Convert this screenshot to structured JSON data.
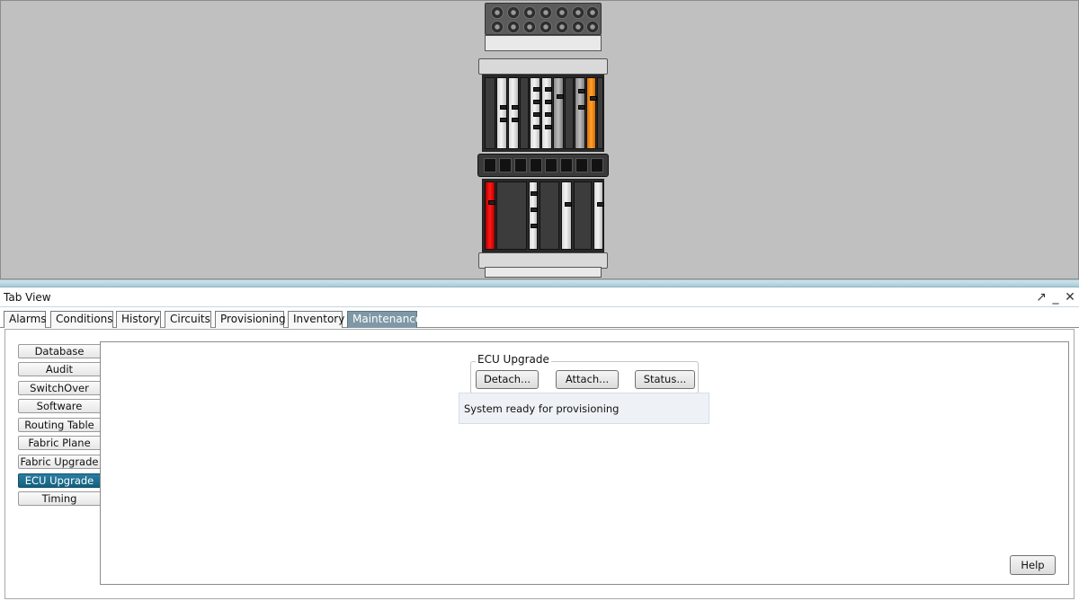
{
  "tab_view": {
    "title": "Tab View",
    "controls": {
      "undock": "↗",
      "minimize": "_",
      "close": "✕"
    }
  },
  "tabs": [
    {
      "label": "Alarms",
      "active": false
    },
    {
      "label": "Conditions",
      "active": false
    },
    {
      "label": "History",
      "active": false
    },
    {
      "label": "Circuits",
      "active": false
    },
    {
      "label": "Provisioning",
      "active": false
    },
    {
      "label": "Inventory",
      "active": false
    },
    {
      "label": "Maintenance",
      "active": true
    }
  ],
  "sidebar": {
    "items": [
      {
        "label": "Database",
        "active": false
      },
      {
        "label": "Audit",
        "active": false
      },
      {
        "label": "SwitchOver",
        "active": false
      },
      {
        "label": "Software",
        "active": false
      },
      {
        "label": "Routing Table",
        "active": false
      },
      {
        "label": "Fabric Plane",
        "active": false
      },
      {
        "label": "Fabric Upgrade",
        "active": false
      },
      {
        "label": "ECU Upgrade",
        "active": true
      },
      {
        "label": "Timing",
        "active": false
      }
    ]
  },
  "ecu_upgrade": {
    "group_label": "ECU Upgrade",
    "detach_label": "Detach...",
    "attach_label": "Attach...",
    "status_label": "Status..."
  },
  "status": {
    "text": "System ready for provisioning"
  },
  "help_label": "Help",
  "colors": {
    "active_tab": "#7f98a6",
    "active_sidebar": "#1a6a8b",
    "card_orange": "#ff9a1f",
    "card_red": "#ff1a1a",
    "chassis_background": "#c0c0c0"
  },
  "icons": {
    "undock": "undock-arrow-icon",
    "minimize": "minimize-icon",
    "close": "close-icon"
  }
}
